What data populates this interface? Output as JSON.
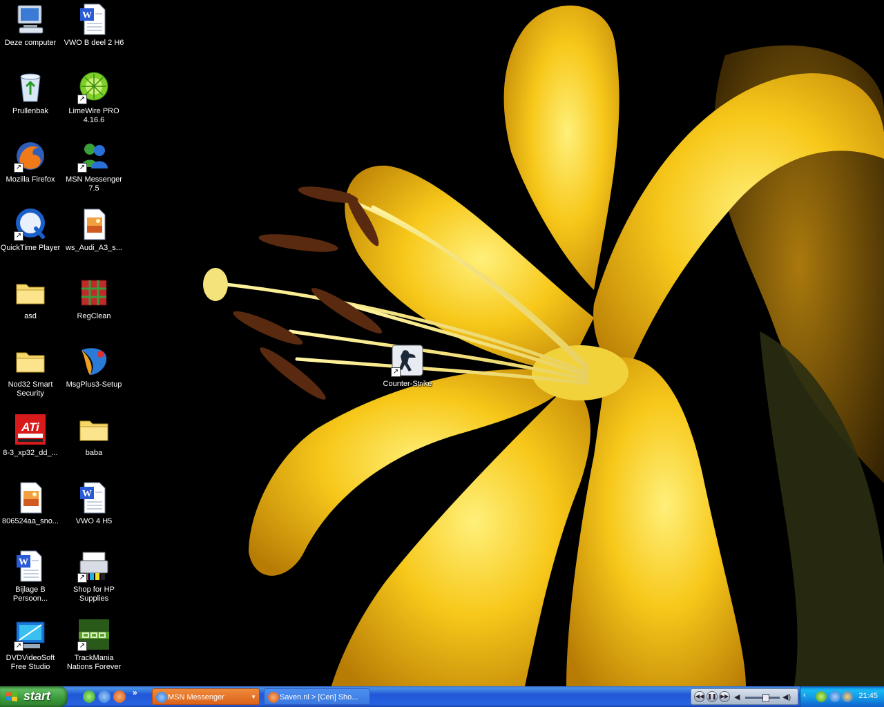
{
  "desktop": {
    "icons": [
      {
        "label": "Deze computer",
        "icon": "my-computer-icon"
      },
      {
        "label": "VWO B deel 2 H6",
        "icon": "word-document-icon"
      },
      {
        "label": "Prullenbak",
        "icon": "recycle-bin-icon"
      },
      {
        "label": "LimeWire PRO 4.16.6",
        "icon": "limewire-icon"
      },
      {
        "label": "Mozilla Firefox",
        "icon": "firefox-icon"
      },
      {
        "label": "MSN Messenger 7.5",
        "icon": "msn-messenger-icon"
      },
      {
        "label": "QuickTime Player",
        "icon": "quicktime-icon"
      },
      {
        "label": "ws_Audi_A3_s...",
        "icon": "image-file-icon"
      },
      {
        "label": "asd",
        "icon": "folder-icon"
      },
      {
        "label": "RegClean",
        "icon": "regclean-icon"
      },
      {
        "label": "Nod32 Smart Security",
        "icon": "folder-icon"
      },
      {
        "label": "MsgPlus3-Setup",
        "icon": "msgplus-icon"
      },
      {
        "label": "8-3_xp32_dd_...",
        "icon": "ati-radeon-icon"
      },
      {
        "label": "baba",
        "icon": "folder-icon"
      },
      {
        "label": "806524aa_sno...",
        "icon": "image-file-icon"
      },
      {
        "label": "VWO 4 H5",
        "icon": "word-document-icon"
      },
      {
        "label": "Bijlage B Persoon...",
        "icon": "word-document-icon"
      },
      {
        "label": "Shop for HP Supplies",
        "icon": "hp-printer-icon"
      },
      {
        "label": "DVDVideoSoft Free Studio",
        "icon": "dvdvideosoft-icon"
      },
      {
        "label": "TrackMania Nations Forever",
        "icon": "trackmania-icon"
      }
    ],
    "floating_icon": {
      "label": "Counter-Strike",
      "icon": "counter-strike-icon"
    }
  },
  "taskbar": {
    "start_label": "start",
    "tasks": [
      {
        "label": "MSN Messenger",
        "icon": "msn-messenger-icon",
        "active": true
      },
      {
        "label": "Saven.nl > [Cen] Sho...",
        "icon": "firefox-icon",
        "active": false
      }
    ],
    "clock": "21:45",
    "volume_level": 0.6
  },
  "colors": {
    "taskbar_blue": "#2157d7",
    "start_green": "#3a9a3a",
    "lily_yellow": "#f5c518"
  }
}
